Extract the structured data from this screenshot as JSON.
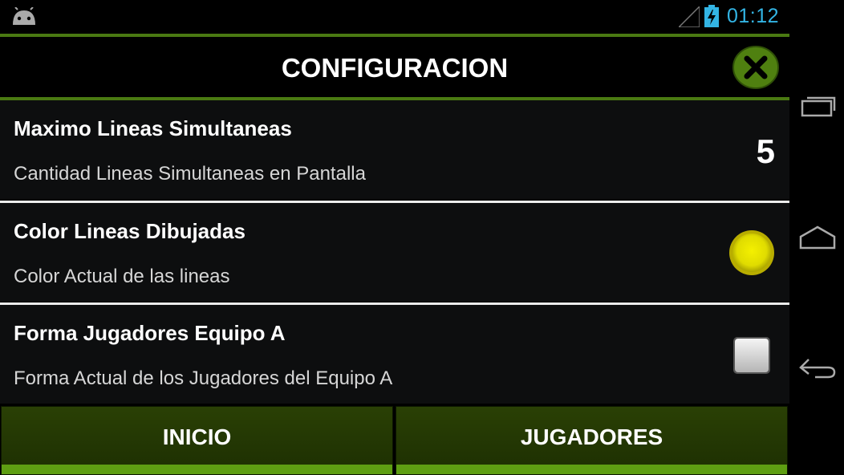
{
  "status_bar": {
    "time": "01:12",
    "icons": [
      "android-icon",
      "signal-icon",
      "battery-charging-icon"
    ]
  },
  "header": {
    "title": "CONFIGURACION",
    "close_icon": "close-icon"
  },
  "settings": [
    {
      "title": "Maximo Lineas Simultaneas",
      "subtitle": "Cantidad Lineas Simultaneas en Pantalla",
      "value": "5"
    },
    {
      "title": "Color Lineas Dibujadas",
      "subtitle": "Color Actual de las lineas",
      "color": "#e5e000"
    },
    {
      "title": "Forma Jugadores Equipo A",
      "subtitle": "Forma Actual de los Jugadores del Equipo A",
      "shape": "square"
    }
  ],
  "bottom_buttons": [
    {
      "label": "INICIO"
    },
    {
      "label": "JUGADORES"
    }
  ],
  "navigation": {
    "icons": [
      "recent-apps-icon",
      "home-icon",
      "back-icon"
    ]
  },
  "colors": {
    "accent_green": "#5e9e12",
    "status_blue": "#33b5e5",
    "button_bg": "#233805"
  }
}
